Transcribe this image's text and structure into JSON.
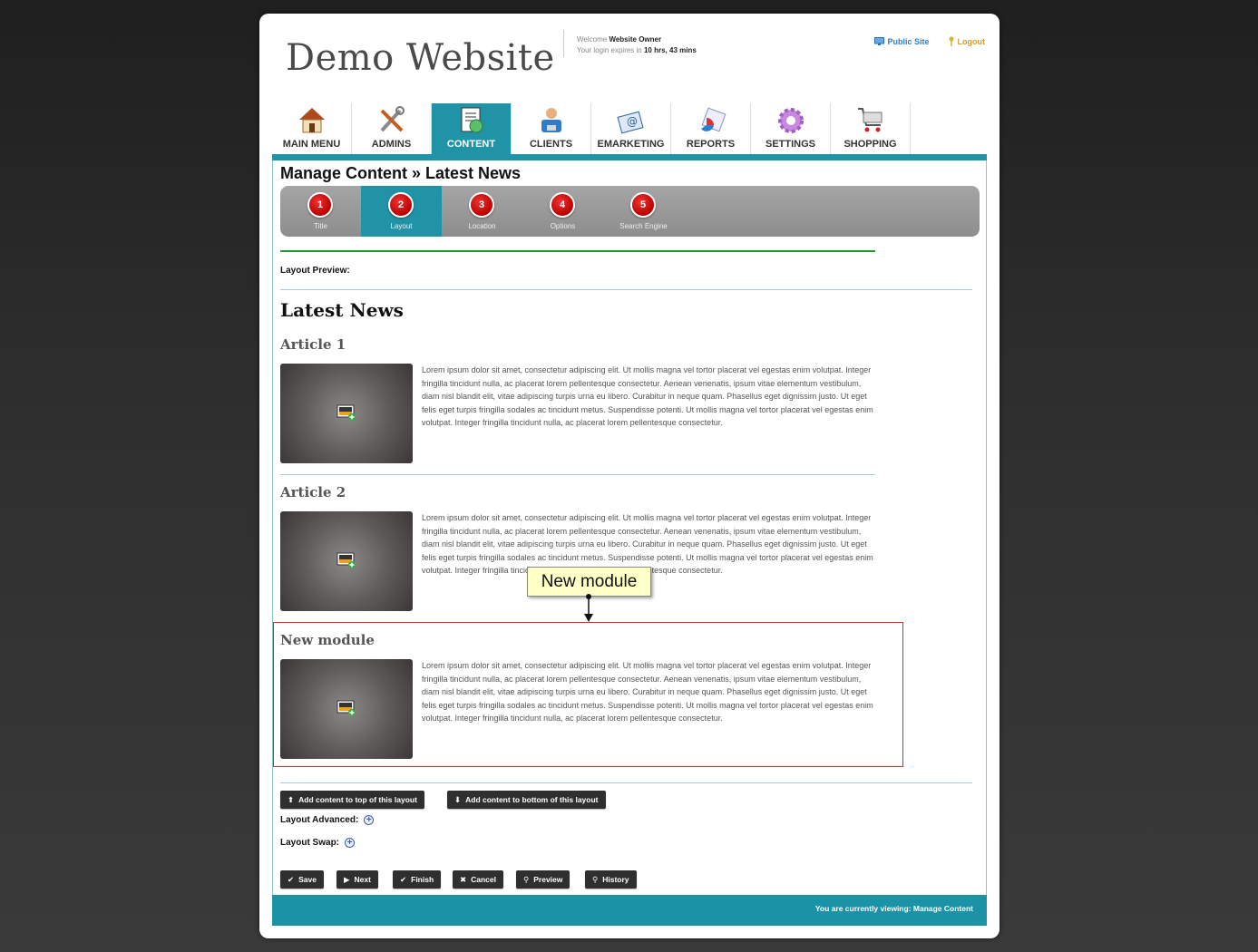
{
  "header": {
    "site_title": "Demo Website",
    "welcome_prefix": "Welcome",
    "user_name": "Website Owner",
    "login_expires_prefix": "Your login expires in",
    "login_expires_value": "10 hrs, 43 mins",
    "public_site_label": "Public Site",
    "logout_label": "Logout"
  },
  "nav": {
    "items": [
      {
        "label": "MAIN MENU",
        "icon": "house-icon"
      },
      {
        "label": "ADMINS",
        "icon": "tools-icon"
      },
      {
        "label": "CONTENT",
        "icon": "document-icon",
        "active": true
      },
      {
        "label": "CLIENTS",
        "icon": "clients-icon"
      },
      {
        "label": "EMARKETING",
        "icon": "email-icon"
      },
      {
        "label": "REPORTS",
        "icon": "reports-icon"
      },
      {
        "label": "SETTINGS",
        "icon": "gear-icon"
      },
      {
        "label": "SHOPPING",
        "icon": "cart-icon"
      }
    ]
  },
  "page": {
    "title": "Manage Content » Latest News"
  },
  "steps": [
    {
      "number": "1",
      "label": "Title"
    },
    {
      "number": "2",
      "label": "Layout",
      "active": true
    },
    {
      "number": "3",
      "label": "Location"
    },
    {
      "number": "4",
      "label": "Options"
    },
    {
      "number": "5",
      "label": "Search Engine"
    }
  ],
  "preview": {
    "label": "Layout Preview:",
    "heading": "Latest News",
    "articles": [
      {
        "title": "Article 1",
        "body": "Lorem ipsum dolor sit amet, consectetur adipiscing elit. Ut mollis magna vel tortor placerat vel egestas enim volutpat. Integer fringilla tincidunt nulla, ac placerat lorem pellentesque consectetur. Aenean venenatis, ipsum vitae elementum vestibulum, diam nisl blandit elit, vitae adipiscing turpis urna eu libero. Curabitur in neque quam. Phasellus eget dignissim justo. Ut eget felis eget turpis fringilla sodales ac tincidunt metus. Suspendisse potenti. Ut mollis magna vel tortor placerat vel egestas enim volutpat. Integer fringilla tincidunt nulla, ac placerat lorem pellentesque consectetur."
      },
      {
        "title": "Article 2",
        "body": "Lorem ipsum dolor sit amet, consectetur adipiscing elit. Ut mollis magna vel tortor placerat vel egestas enim volutpat. Integer fringilla tincidunt nulla, ac placerat lorem pellentesque consectetur. Aenean venenatis, ipsum vitae elementum vestibulum, diam nisl blandit elit, vitae adipiscing turpis urna eu libero. Curabitur in neque quam. Phasellus eget dignissim justo. Ut eget felis eget turpis fringilla sodales ac tincidunt metus. Suspendisse potenti. Ut mollis magna vel tortor placerat vel egestas enim volutpat. Integer fringilla tincidunt nulla, ac placerat lorem pellentesque consectetur."
      },
      {
        "title": "New module",
        "body": "Lorem ipsum dolor sit amet, consectetur adipiscing elit. Ut mollis magna vel tortor placerat vel egestas enim volutpat. Integer fringilla tincidunt nulla, ac placerat lorem pellentesque consectetur. Aenean venenatis, ipsum vitae elementum vestibulum, diam nisl blandit elit, vitae adipiscing turpis urna eu libero. Curabitur in neque quam. Phasellus eget dignissim justo. Ut eget felis eget turpis fringilla sodales ac tincidunt metus. Suspendisse potenti. Ut mollis magna vel tortor placerat vel egestas enim volutpat. Integer fringilla tincidunt nulla, ac placerat lorem pellentesque consectetur."
      }
    ],
    "tooltip": "New module"
  },
  "layout_actions": {
    "add_top": "Add content to top of this layout",
    "add_bottom": "Add content to bottom of this layout",
    "advanced_label": "Layout Advanced:",
    "swap_label": "Layout Swap:"
  },
  "actions": {
    "save": "Save",
    "next": "Next",
    "finish": "Finish",
    "cancel": "Cancel",
    "preview": "Preview",
    "history": "History"
  },
  "footer": {
    "status": "You are currently viewing: Manage Content"
  },
  "colors": {
    "accent": "#2093a6",
    "step_circle": "#cc1111",
    "highlight_box": "#e8202a",
    "green_rule": "#1d9a2e"
  }
}
